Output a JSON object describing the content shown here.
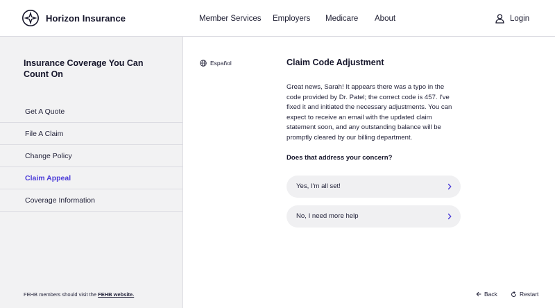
{
  "header": {
    "brand": "Horizon Insurance",
    "nav": [
      "Member Services",
      "Employers",
      "Medicare",
      "About"
    ],
    "login_label": "Login"
  },
  "sidebar": {
    "title": "Insurance Coverage You Can Count On",
    "items": [
      {
        "label": "Get A Quote"
      },
      {
        "label": "File A Claim"
      },
      {
        "label": "Change Policy"
      },
      {
        "label": "Claim Appeal",
        "active": true
      },
      {
        "label": "Coverage Information"
      }
    ],
    "footnote_prefix": "FEHB members should visit the",
    "footnote_link": "FEHB website."
  },
  "language": {
    "label": "Español"
  },
  "main": {
    "title": "Claim Code Adjustment",
    "body": "Great news, Sarah! It appears there was a typo in the code provided by Dr. Patel; the correct code is 457. I've fixed it and initiated the necessary adjustments. You can expect to receive an email with the updated claim statement soon, and any outstanding balance will be promptly cleared by our billing department.",
    "question": "Does that address your concern?",
    "choices": [
      {
        "label": "Yes, I'm all set!"
      },
      {
        "label": "No, I need more help"
      }
    ]
  },
  "footer": {
    "back_label": "Back",
    "restart_label": "Restart"
  },
  "colors": {
    "accent": "#4a3ad8",
    "sidebar_bg": "#f2f2f3",
    "text_dark": "#15152a"
  },
  "icons": [
    "horizon-logo-icon",
    "user-icon",
    "globe-icon",
    "chevron-right-icon",
    "arrow-left-icon",
    "restart-icon"
  ]
}
